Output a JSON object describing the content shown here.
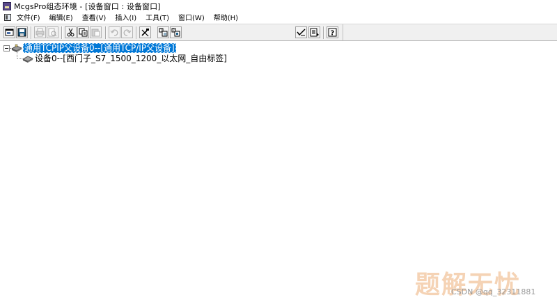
{
  "window": {
    "title": "McgsPro组态环境 - [设备窗口 : 设备窗口]"
  },
  "menubar": {
    "items": [
      {
        "label": "文件(F)"
      },
      {
        "label": "编辑(E)"
      },
      {
        "label": "查看(V)"
      },
      {
        "label": "插入(I)"
      },
      {
        "label": "工具(T)"
      },
      {
        "label": "窗口(W)"
      },
      {
        "label": "帮助(H)"
      }
    ]
  },
  "toolbar": {
    "buttons": [
      {
        "icon": "open-window-icon",
        "enabled": true
      },
      {
        "icon": "save-icon",
        "enabled": true
      },
      {
        "icon": "print-icon",
        "enabled": false
      },
      {
        "icon": "print-preview-icon",
        "enabled": false
      },
      {
        "icon": "cut-icon",
        "enabled": true
      },
      {
        "icon": "copy-icon",
        "enabled": true
      },
      {
        "icon": "paste-icon",
        "enabled": false
      },
      {
        "icon": "undo-icon",
        "enabled": false
      },
      {
        "icon": "redo-icon",
        "enabled": false
      },
      {
        "icon": "device-tools-icon",
        "enabled": true
      },
      {
        "icon": "device-properties-icon",
        "enabled": true
      },
      {
        "icon": "device-config-icon",
        "enabled": true
      },
      {
        "icon": "check-icon",
        "enabled": true
      },
      {
        "icon": "list-icon",
        "enabled": true
      },
      {
        "icon": "help-icon",
        "enabled": true
      }
    ]
  },
  "tree": {
    "root": {
      "label": "通用TCPIP父设备0--[通用TCP/IP父设备]",
      "icon": "device-parent-icon",
      "expanded": true,
      "selected": true
    },
    "children": [
      {
        "label": "设备0--[西门子_S7_1500_1200_以太网_自由标签]",
        "icon": "device-child-icon"
      }
    ]
  },
  "watermarks": {
    "logo": "题解无忧",
    "csdn": "CSDN @qq_32311881"
  },
  "colors": {
    "selection": "#0078d7",
    "toolbar_bg": "#f0f0f0",
    "logo_watermark": "#ecae78"
  }
}
